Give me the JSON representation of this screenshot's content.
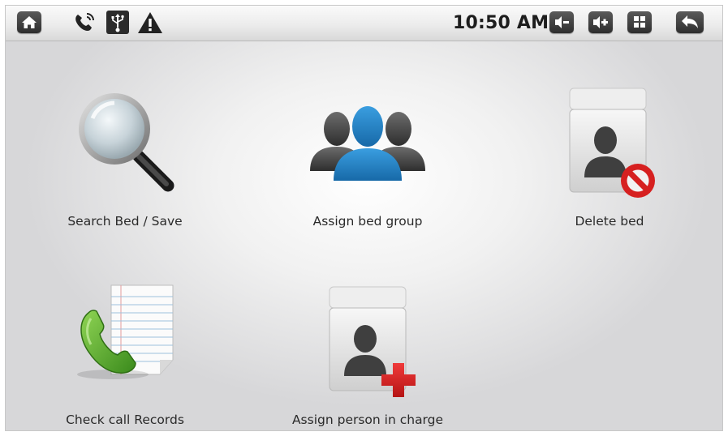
{
  "status_bar": {
    "time": "10:50 AM",
    "left_icons": [
      "home-icon",
      "phone-ringing-icon",
      "usb-icon",
      "warning-icon"
    ],
    "right_buttons": [
      "volume-down-icon",
      "volume-up-icon",
      "app-grid-icon",
      "back-arrow-icon"
    ]
  },
  "menu": {
    "items": [
      {
        "label": "Search Bed / Save",
        "icon": "magnifier-icon"
      },
      {
        "label": "Assign bed group",
        "icon": "user-group-icon"
      },
      {
        "label": "Delete bed",
        "icon": "contact-card-delete-icon"
      },
      {
        "label": "Check call Records",
        "icon": "phone-notepad-icon"
      },
      {
        "label": "Assign person in charge",
        "icon": "contact-card-add-icon"
      }
    ]
  },
  "colors": {
    "status_bar_button": "#3a3a3a",
    "accent_blue": "#2d86c7",
    "phone_green": "#5cae2f",
    "delete_red": "#d62020"
  }
}
